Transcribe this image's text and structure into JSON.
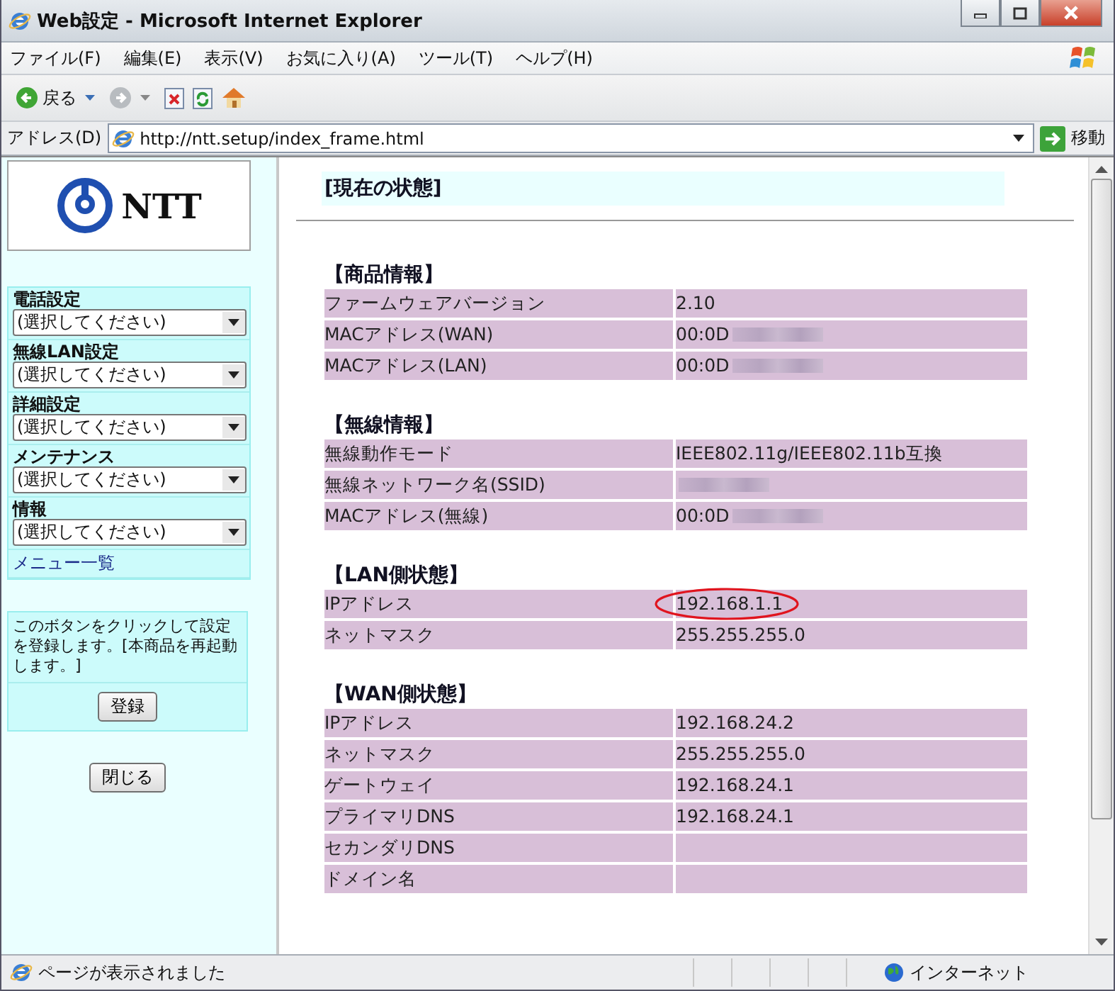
{
  "window": {
    "title": "Web設定 - Microsoft Internet Explorer"
  },
  "menu_bar": [
    "ファイル(F)",
    "編集(E)",
    "表示(V)",
    "お気に入り(A)",
    "ツール(T)",
    "ヘルプ(H)"
  ],
  "toolbar": {
    "back_label": "戻る"
  },
  "address_bar": {
    "label": "アドレス(D)",
    "url": "http://ntt.setup/index_frame.html",
    "go_label": "移動"
  },
  "sidebar": {
    "logo": "NTT",
    "groups": [
      {
        "label": "電話設定",
        "value": "(選択してください)"
      },
      {
        "label": "無線LAN設定",
        "value": "(選択してください)"
      },
      {
        "label": "詳細設定",
        "value": "(選択してください)"
      },
      {
        "label": "メンテナンス",
        "value": "(選択してください)"
      },
      {
        "label": "情報",
        "value": "(選択してください)"
      }
    ],
    "menu_link": "メニュー一覧",
    "note": "このボタンをクリックして設定を登録します。[本商品を再起動します。]",
    "register_button": "登録",
    "close_button": "閉じる"
  },
  "content": {
    "heading": "[現在の状態]",
    "sections": [
      {
        "title": "【商品情報】",
        "rows": [
          {
            "label": "ファームウェアバージョン",
            "value": "2.10",
            "redacted": false,
            "highlighted": false
          },
          {
            "label": "MACアドレス(WAN)",
            "value": "00:0D",
            "redacted": true,
            "highlighted": false
          },
          {
            "label": "MACアドレス(LAN)",
            "value": "00:0D",
            "redacted": true,
            "highlighted": false
          }
        ]
      },
      {
        "title": "【無線情報】",
        "rows": [
          {
            "label": "無線動作モード",
            "value": "IEEE802.11g/IEEE802.11b互換",
            "redacted": false,
            "highlighted": false
          },
          {
            "label": "無線ネットワーク名(SSID)",
            "redacted": true,
            "highlighted": false
          },
          {
            "label": "MACアドレス(無線)",
            "value": "00:0D",
            "redacted": true,
            "highlighted": false
          }
        ]
      },
      {
        "title": "【LAN側状態】",
        "rows": [
          {
            "label": "IPアドレス",
            "value": "192.168.1.1",
            "redacted": false,
            "highlighted": true
          },
          {
            "label": "ネットマスク",
            "value": "255.255.255.0",
            "redacted": false,
            "highlighted": false
          }
        ]
      },
      {
        "title": "【WAN側状態】",
        "rows": [
          {
            "label": "IPアドレス",
            "value": "192.168.24.2",
            "redacted": false,
            "highlighted": false
          },
          {
            "label": "ネットマスク",
            "value": "255.255.255.0",
            "redacted": false,
            "highlighted": false
          },
          {
            "label": "ゲートウェイ",
            "value": "192.168.24.1",
            "redacted": false,
            "highlighted": false
          },
          {
            "label": "プライマリDNS",
            "value": "192.168.24.1",
            "redacted": false,
            "highlighted": false
          },
          {
            "label": "セカンダリDNS",
            "redacted": false,
            "highlighted": false
          },
          {
            "label": "ドメイン名",
            "redacted": false,
            "highlighted": false
          }
        ]
      }
    ]
  },
  "status_bar": {
    "text": "ページが表示されました",
    "zone": "インターネット"
  }
}
